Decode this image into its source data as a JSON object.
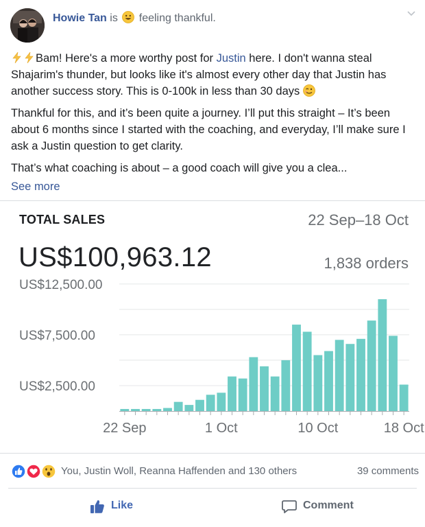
{
  "post": {
    "author": "Howie Tan",
    "is_text": "is",
    "feeling_text": "feeling thankful.",
    "feeling_icon": "smiley-emoji-icon",
    "paragraph1_before_mention1": "Bam! Here's a more worthy post for ",
    "mention1": "Justin",
    "paragraph1_after_mention1": " here. I don't wanna steal Shajarim's thunder, but looks like it's almost every other day that Justin has another success story. This is 0-100k in less than 30 days",
    "paragraph2": "Thankful for this, and it’s been quite a journey. I’ll put this straight – It’s been about 6 months since I started with the coaching, and everyday, I’ll make sure I ask a Justin question to get clarity.",
    "paragraph3": "That’s what coaching is about – a good coach will give you a clea...",
    "see_more": "See more",
    "accent_color": "#385898"
  },
  "sales_card": {
    "title": "TOTAL SALES",
    "date_range": "22 Sep–18 Oct",
    "amount": "US$100,963.12",
    "orders": "1,838 orders",
    "bar_color": "#6ecdc6"
  },
  "chart_data": {
    "type": "bar",
    "title": "TOTAL SALES",
    "ylabel": "",
    "xlabel": "",
    "ylim": [
      0,
      13500
    ],
    "y_ticks": [
      2500,
      7500,
      12500
    ],
    "y_tick_labels": [
      "US$2,500.00",
      "US$7,500.00",
      "US$12,500.00"
    ],
    "x_tick_labels": [
      "22 Sep",
      "1 Oct",
      "10 Oct",
      "18 Oct"
    ],
    "x_tick_indices": [
      0,
      9,
      18,
      26
    ],
    "categories": [
      "22 Sep",
      "23 Sep",
      "24 Sep",
      "25 Sep",
      "26 Sep",
      "27 Sep",
      "28 Sep",
      "29 Sep",
      "30 Sep",
      "1 Oct",
      "2 Oct",
      "3 Oct",
      "4 Oct",
      "5 Oct",
      "6 Oct",
      "7 Oct",
      "8 Oct",
      "9 Oct",
      "10 Oct",
      "11 Oct",
      "12 Oct",
      "13 Oct",
      "14 Oct",
      "15 Oct",
      "16 Oct",
      "17 Oct",
      "18 Oct"
    ],
    "values": [
      200,
      200,
      200,
      200,
      300,
      900,
      600,
      1100,
      1600,
      1800,
      3400,
      3200,
      5300,
      4400,
      3400,
      5000,
      8500,
      7800,
      5500,
      5900,
      7000,
      6600,
      7100,
      8900,
      11000,
      7400,
      2600
    ],
    "grid": true,
    "legend": "none"
  },
  "reactions": {
    "icons": [
      "like-reaction-icon",
      "love-reaction-icon",
      "wow-reaction-icon"
    ],
    "text": "You, Justin Woll, Reanna Haffenden and 130 others",
    "comments": "39 comments"
  },
  "actions": {
    "like": "Like",
    "comment": "Comment"
  }
}
